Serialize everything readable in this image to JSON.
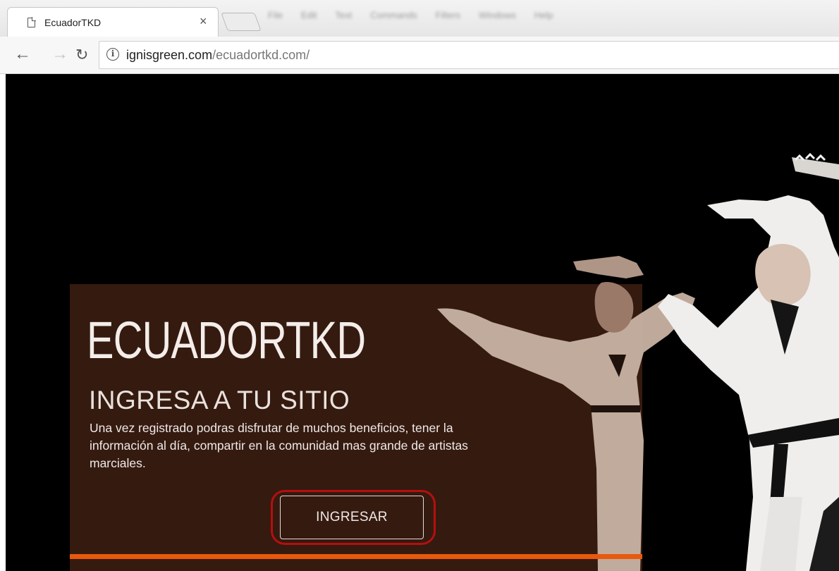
{
  "browser": {
    "tab_title": "EcuadorTKD",
    "tab_close": "×",
    "url_host": "ignisgreen.com",
    "url_path": "/ecuadortkd.com/",
    "blurred_menu": [
      "File",
      "Edit",
      "Text",
      "Commands",
      "Filters",
      "Windows",
      "Help"
    ]
  },
  "hero": {
    "brand": "ECUADORTKD",
    "headline": "INGRESA A TU SITIO",
    "description": "Una vez registrado podras disfrutar de muchos beneficios, tener la información al día, compartir en la comunidad mas grande de artistas marciales.",
    "cta_label": "INGRESAR"
  },
  "colors": {
    "page_background": "#000000",
    "panel": "#351a10",
    "accent_underline": "#e8590c",
    "highlight_ring": "#b50f0f"
  },
  "icons": [
    "page-icon",
    "close-icon",
    "back-arrow-icon",
    "forward-arrow-icon",
    "reload-icon",
    "info-icon"
  ]
}
